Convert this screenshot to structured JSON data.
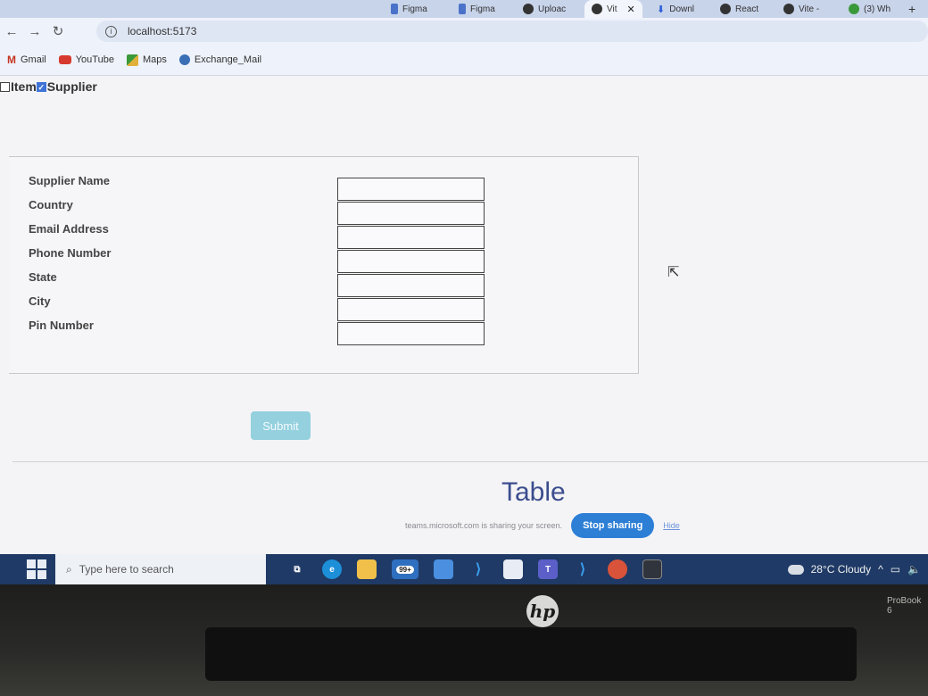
{
  "browser": {
    "tabs": [
      {
        "label": "Figma"
      },
      {
        "label": "Figma"
      },
      {
        "label": "Uploac"
      },
      {
        "label": "Vit"
      },
      {
        "label": "Downl"
      },
      {
        "label": "React"
      },
      {
        "label": "Vite -"
      },
      {
        "label": "(3) Wh"
      }
    ],
    "url": "localhost:5173",
    "bookmarks": [
      "Gmail",
      "YouTube",
      "Maps",
      "Exchange_Mail"
    ]
  },
  "toggles": {
    "item_label": "Item",
    "item_checked": false,
    "supplier_label": "Supplier",
    "supplier_checked": true
  },
  "form": {
    "fields": [
      {
        "label": "Supplier Name",
        "value": ""
      },
      {
        "label": "Country",
        "value": ""
      },
      {
        "label": "Email Address",
        "value": ""
      },
      {
        "label": "Phone Number",
        "value": ""
      },
      {
        "label": "State",
        "value": ""
      },
      {
        "label": "City",
        "value": ""
      },
      {
        "label": "Pin Number",
        "value": ""
      }
    ],
    "submit_label": "Submit"
  },
  "table_heading": "Table",
  "screen_share": {
    "message": "teams.microsoft.com is sharing your screen.",
    "stop_label": "Stop sharing",
    "hide_label": "Hide"
  },
  "taskbar": {
    "search_placeholder": "Type here to search",
    "mail_badge": "99+",
    "weather": "28°C  Cloudy"
  },
  "laptop": {
    "brand": "hp",
    "model": "ProBook 6"
  },
  "colors": {
    "submit_bg": "#94d0de",
    "table_heading": "#3c4d8e",
    "stop_sharing_bg": "#2d7fd6",
    "taskbar_bg": "#1f3a66"
  }
}
